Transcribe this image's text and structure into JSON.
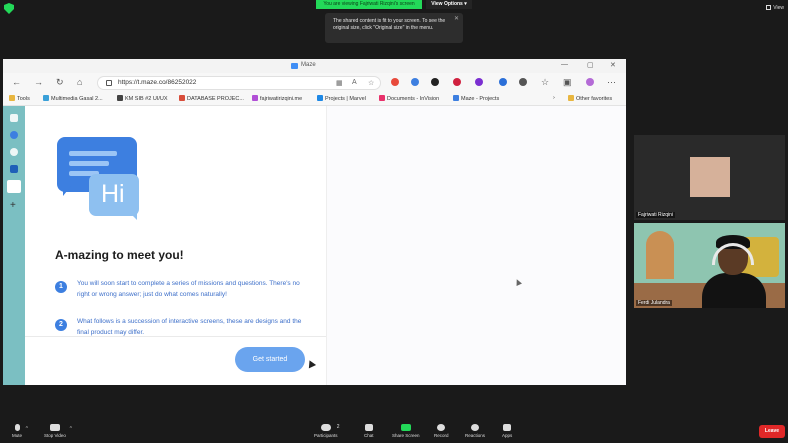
{
  "zoom": {
    "viewing_banner": "You are viewing Fajriwati Rizqini's screen",
    "view_options_label": "View Options ▾",
    "tooltip_text": "The shared content is fit to your screen. To see the original size, click \"Original size\" in the menu.",
    "top_right_view": "View",
    "participants_count": "2",
    "toolbar": {
      "mute": "Mute",
      "stop_video": "Stop Video",
      "participants": "Participants",
      "chat": "Chat",
      "share_screen": "Share Screen",
      "record": "Record",
      "reactions": "Reactions",
      "apps": "Apps",
      "leave": "Leave"
    },
    "accent_green": "#23d959",
    "leave_red": "#e02828"
  },
  "participants": [
    {
      "name": "Fajriwati Rizqini"
    },
    {
      "name": "Ferdi Julandra"
    }
  ],
  "browser": {
    "tab_title": "Maze",
    "url": "https://t.maze.co/86252022",
    "bookmarks": [
      {
        "label": "Tools",
        "icon": "folder-icon"
      },
      {
        "label": "Multimedia Gasal 2...",
        "icon": "site-icon"
      },
      {
        "label": "KM SIB #2 UI/UX",
        "icon": "site-icon"
      },
      {
        "label": "DATABASE PROJEC...",
        "icon": "site-icon"
      },
      {
        "label": "fajriwatirizqini.me",
        "icon": "site-icon"
      },
      {
        "label": "Projects | Marvel",
        "icon": "site-icon"
      },
      {
        "label": "Documents - InVision",
        "icon": "site-icon"
      },
      {
        "label": "Maze - Projects",
        "icon": "site-icon"
      },
      {
        "label": "Other favorites",
        "icon": "folder-icon"
      }
    ]
  },
  "maze": {
    "hi_label": "Hi",
    "headline": "A-mazing to meet you!",
    "steps": [
      {
        "number": "1",
        "text": "You will soon start to complete a series of missions and questions. There's no right or wrong answer; just do what comes naturally!"
      },
      {
        "number": "2",
        "text": "What follows is a succession of interactive screens, these are designs and the final product may differ."
      }
    ],
    "cta_label": "Get started",
    "brand_blue": "#3d7fe0"
  }
}
